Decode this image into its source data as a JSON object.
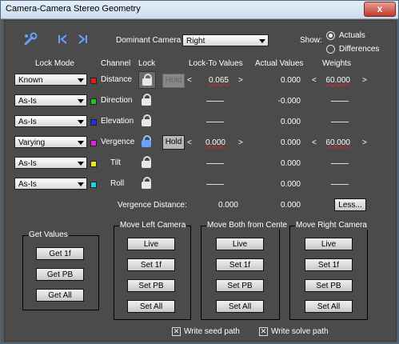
{
  "window": {
    "title": "Camera-Camera Stereo Geometry",
    "close_glyph": "x"
  },
  "toolbar": {
    "tool_icon": "wrench-icon",
    "prev_icon": "skip-to-start-icon",
    "next_icon": "skip-to-end-icon",
    "dominant_label": "Dominant Camera",
    "dominant_value": "Right",
    "show_label": "Show:",
    "show_actuals": "Actuals",
    "show_differences": "Differences",
    "show_selected": "Actuals"
  },
  "headers": {
    "lock_mode": "Lock Mode",
    "channel": "Channel",
    "lock": "Lock",
    "lock_to": "Lock-To Values",
    "actual": "Actual Values",
    "weights": "Weights"
  },
  "arrows": {
    "left": "<",
    "right": ">"
  },
  "dash": "——",
  "hold_label": "Hold",
  "rows": [
    {
      "mode": "Known",
      "channel": "Distance",
      "color": "#e02020",
      "lockto": "0.065",
      "actual": "0.000",
      "weight": "60.000"
    },
    {
      "mode": "As-Is",
      "channel": "Direction",
      "color": "#20c020",
      "lockto": "",
      "actual": "-0.000",
      "weight": ""
    },
    {
      "mode": "As-Is",
      "channel": "Elevation",
      "color": "#2030e0",
      "lockto": "",
      "actual": "0.000",
      "weight": ""
    },
    {
      "mode": "Varying",
      "channel": "Vergence",
      "color": "#e020e0",
      "lockto": "0.000",
      "actual": "0.000",
      "weight": "60.000"
    },
    {
      "mode": "As-Is",
      "channel": "Tilt",
      "color": "#e8e820",
      "lockto": "",
      "actual": "0.000",
      "weight": ""
    },
    {
      "mode": "As-Is",
      "channel": "Roll",
      "color": "#20d0e0",
      "lockto": "",
      "actual": "0.000",
      "weight": ""
    }
  ],
  "vergence_distance": {
    "label": "Vergence Distance:",
    "lockto": "0.000",
    "actual": "0.000"
  },
  "less_button": "Less...",
  "groups": {
    "get_values": {
      "title": "Get Values",
      "buttons": [
        "Get 1f",
        "Get PB",
        "Get All"
      ]
    },
    "move_left": {
      "title": "Move Left Camera",
      "buttons": [
        "Live",
        "Set 1f",
        "Set PB",
        "Set All"
      ]
    },
    "move_both": {
      "title": "Move Both from Cente",
      "buttons": [
        "Live",
        "Set 1f",
        "Set PB",
        "Set All"
      ]
    },
    "move_right": {
      "title": "Move Right Camera",
      "buttons": [
        "Live",
        "Set 1f",
        "Set PB",
        "Set All"
      ]
    }
  },
  "checkboxes": {
    "seed": "Write seed path",
    "solve": "Write solve path",
    "glyph": "✕"
  }
}
